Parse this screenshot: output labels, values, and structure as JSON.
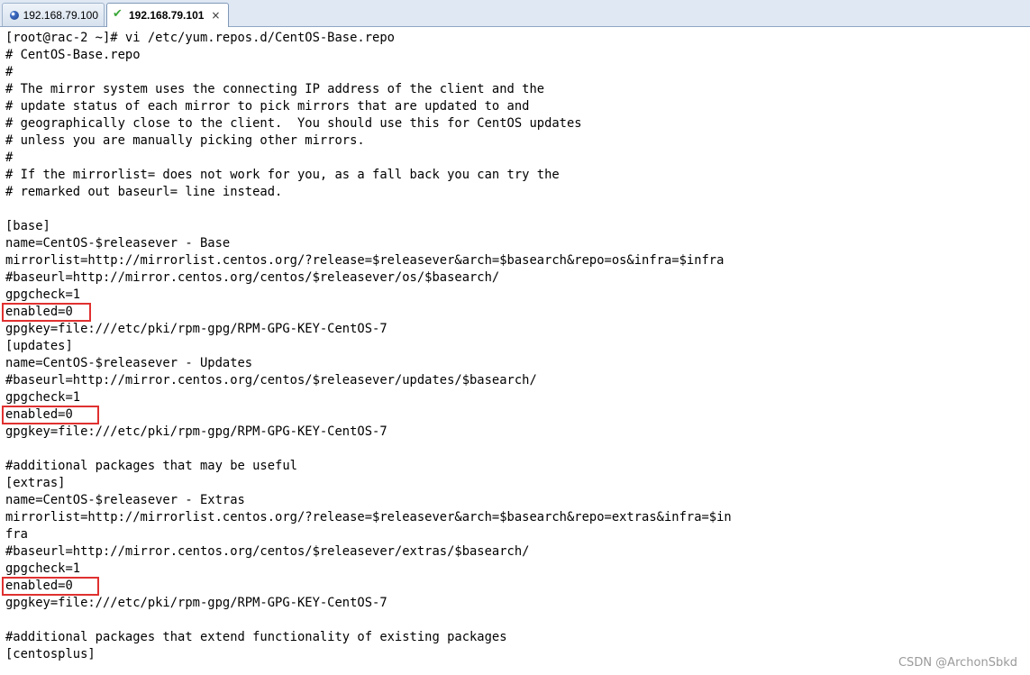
{
  "tabs": [
    {
      "label": "192.168.79.100",
      "icon": "status-dot-icon",
      "active": false
    },
    {
      "label": "192.168.79.101",
      "icon": "checkmark-icon",
      "active": true,
      "close": "×"
    }
  ],
  "terminal": {
    "lines": [
      "[root@rac-2 ~]# vi /etc/yum.repos.d/CentOS-Base.repo",
      "# CentOS-Base.repo",
      "#",
      "# The mirror system uses the connecting IP address of the client and the",
      "# update status of each mirror to pick mirrors that are updated to and",
      "# geographically close to the client.  You should use this for CentOS updates",
      "# unless you are manually picking other mirrors.",
      "#",
      "# If the mirrorlist= does not work for you, as a fall back you can try the",
      "# remarked out baseurl= line instead.",
      "",
      "[base]",
      "name=CentOS-$releasever - Base",
      "mirrorlist=http://mirrorlist.centos.org/?release=$releasever&arch=$basearch&repo=os&infra=$infra",
      "#baseurl=http://mirror.centos.org/centos/$releasever/os/$basearch/",
      "gpgcheck=1",
      "enabled=0",
      "gpgkey=file:///etc/pki/rpm-gpg/RPM-GPG-KEY-CentOS-7",
      "[updates]",
      "name=CentOS-$releasever - Updates",
      "#baseurl=http://mirror.centos.org/centos/$releasever/updates/$basearch/",
      "gpgcheck=1",
      "enabled=0",
      "gpgkey=file:///etc/pki/rpm-gpg/RPM-GPG-KEY-CentOS-7",
      "",
      "#additional packages that may be useful",
      "[extras]",
      "name=CentOS-$releasever - Extras",
      "mirrorlist=http://mirrorlist.centos.org/?release=$releasever&arch=$basearch&repo=extras&infra=$in",
      "fra",
      "#baseurl=http://mirror.centos.org/centos/$releasever/extras/$basearch/",
      "gpgcheck=1",
      "enabled=0",
      "gpgkey=file:///etc/pki/rpm-gpg/RPM-GPG-KEY-CentOS-7",
      "",
      "#additional packages that extend functionality of existing packages",
      "[centosplus]"
    ],
    "highlighted_line_indices": [
      16,
      22,
      32
    ],
    "highlight_color": "#e03030"
  },
  "watermark": "CSDN @ArchonSbkd"
}
